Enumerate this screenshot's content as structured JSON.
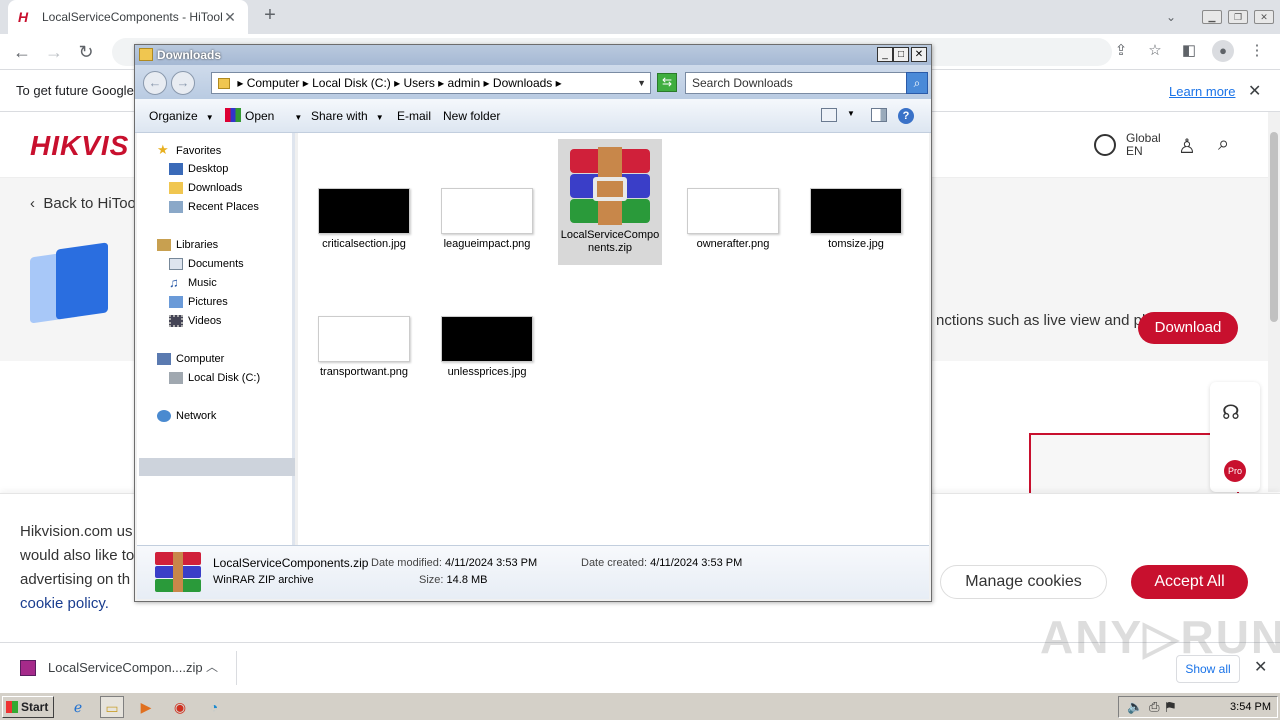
{
  "browser": {
    "tab_title": "LocalServiceComponents - HiTools - H",
    "tab_favicon": "H",
    "new_tab": "+",
    "tab_search": "⌄"
  },
  "infobar": {
    "text": "To get future Google",
    "learn_more": "Learn more"
  },
  "site": {
    "logo": "HIKVIS",
    "lang_top": "Global",
    "lang_bottom": "EN",
    "back_link": "Back to HiToo",
    "desc_fragment": "nctions such as live view and playback.",
    "download_label": "Download"
  },
  "cookie": {
    "text_lines": [
      "Hikvision.com us",
      "would also like to",
      "advertising on th"
    ],
    "policy_link": "cookie policy.",
    "manage_label": "Manage cookies",
    "accept_label": "Accept All"
  },
  "download_shelf": {
    "item_name": "LocalServiceCompon....zip",
    "show_all": "Show all"
  },
  "watermark": "ANY▷RUN",
  "taskbar": {
    "start_label": "Start",
    "clock": "3:54 PM"
  },
  "explorer": {
    "title": "Downloads",
    "address": [
      "Computer",
      "Local Disk (C:)",
      "Users",
      "admin",
      "Downloads"
    ],
    "search_placeholder": "Search Downloads",
    "commands": {
      "organize": "Organize",
      "open": "Open",
      "share_with": "Share with",
      "email": "E-mail",
      "new_folder": "New folder"
    },
    "nav": {
      "favorites": "Favorites",
      "desktop": "Desktop",
      "downloads": "Downloads",
      "recent_places": "Recent Places",
      "libraries": "Libraries",
      "documents": "Documents",
      "music": "Music",
      "pictures": "Pictures",
      "videos": "Videos",
      "computer": "Computer",
      "local_disk": "Local Disk (C:)",
      "network": "Network"
    },
    "files": [
      {
        "name": "criticalsection.jpg"
      },
      {
        "name": "leagueimpact.png"
      },
      {
        "name": "LocalServiceComponents.zip"
      },
      {
        "name": "ownerafter.png"
      },
      {
        "name": "tomsize.jpg"
      },
      {
        "name": "transportwant.png"
      },
      {
        "name": "unlessprices.jpg"
      }
    ],
    "details": {
      "filename": "LocalServiceComponents.zip",
      "type": "WinRAR ZIP archive",
      "date_modified_label": "Date modified:",
      "date_modified": "4/11/2024 3:53 PM",
      "size_label": "Size:",
      "size": "14.8 MB",
      "date_created_label": "Date created:",
      "date_created": "4/11/2024 3:53 PM"
    }
  }
}
